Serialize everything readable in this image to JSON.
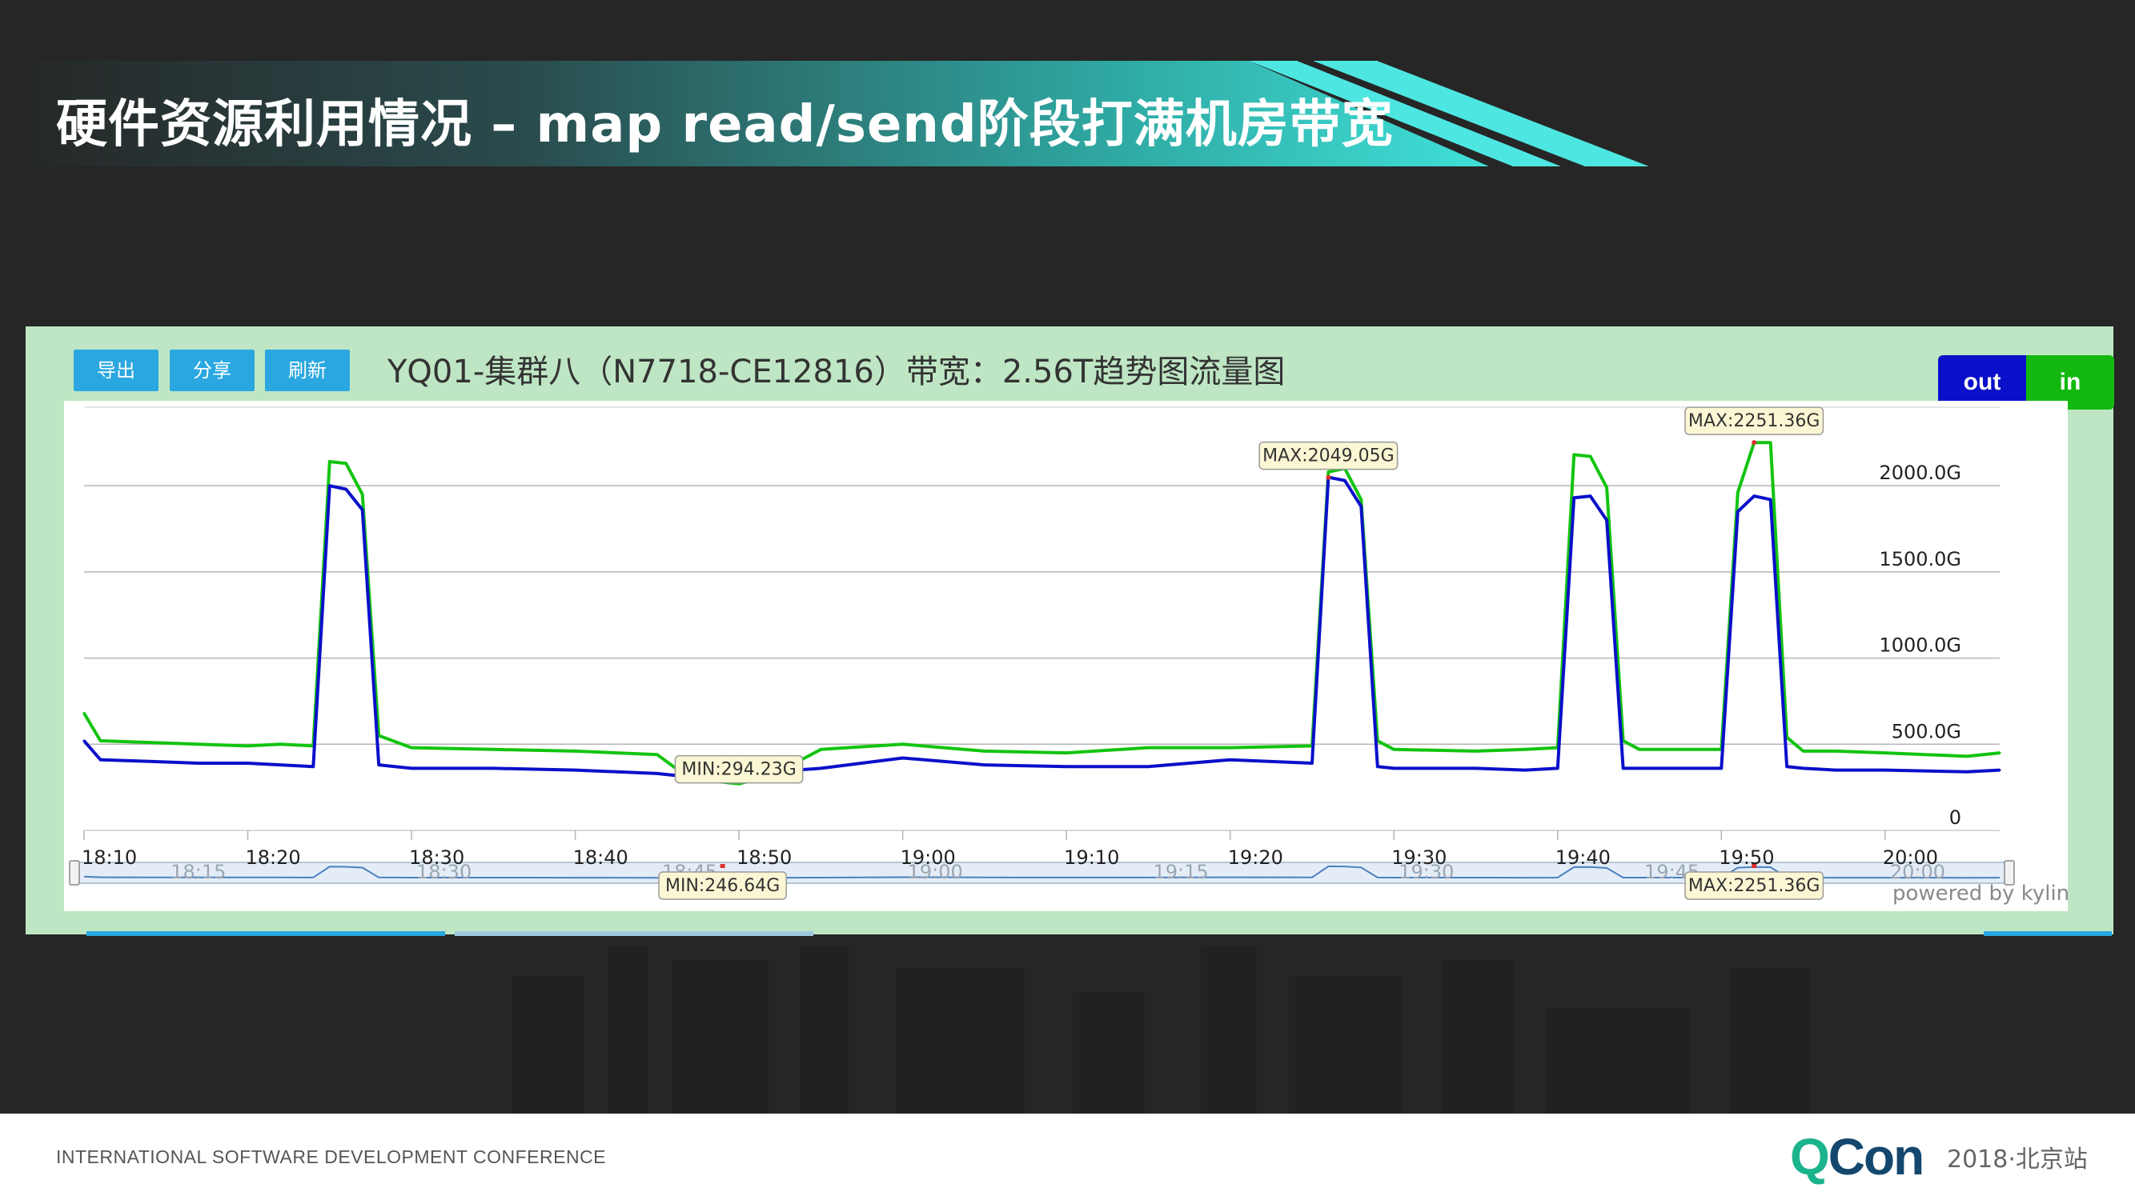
{
  "slide": {
    "title": "硬件资源利用情况 – map read/send阶段打满机房带宽",
    "conference": "INTERNATIONAL SOFTWARE DEVELOPMENT CONFERENCE",
    "logo_q": "Q",
    "logo_con": "Con",
    "edition": "2018·北京站"
  },
  "toolbar": {
    "export_label": "导出",
    "share_label": "分享",
    "refresh_label": "刷新"
  },
  "toggles": {
    "out_label": "out",
    "in_label": "in"
  },
  "powered_by": "powered by kylin",
  "colors": {
    "in": "#12c40f",
    "out": "#0a10c9",
    "accent": "#2aa7e0",
    "panel": "#bfe6c4"
  },
  "chart_data": {
    "type": "line",
    "title": "YQ01-集群八（N7718-CE12816）带宽：2.56T趋势图流量图",
    "xlabel": "",
    "ylabel": "",
    "x_range": [
      "18:10",
      "20:07"
    ],
    "ylim": [
      0,
      2400
    ],
    "y_ticks": [
      0,
      500,
      1000,
      1500,
      2000
    ],
    "y_tick_labels": [
      "0",
      "500.0G",
      "1000.0G",
      "1500.0G",
      "2000.0G"
    ],
    "x_tick_labels": [
      "18:10",
      "18:20",
      "18:30",
      "18:40",
      "18:50",
      "19:00",
      "19:10",
      "19:20",
      "19:30",
      "19:40",
      "19:50",
      "20:00"
    ],
    "navigator_tick_labels": [
      "18:15",
      "18:30",
      "18:45",
      "19:00",
      "19:15",
      "19:30",
      "19:45",
      "20:00"
    ],
    "grid": "horizontal",
    "legend": "top-right toggles",
    "series": [
      {
        "name": "in",
        "color": "#12c40f",
        "x": [
          "18:10",
          "18:11",
          "18:14",
          "18:17",
          "18:20",
          "18:22",
          "18:24",
          "18:25",
          "18:26",
          "18:27",
          "18:28",
          "18:30",
          "18:35",
          "18:40",
          "18:45",
          "18:47",
          "18:50",
          "18:52",
          "18:55",
          "19:00",
          "19:05",
          "19:10",
          "19:15",
          "19:20",
          "19:25",
          "19:26",
          "19:27",
          "19:28",
          "19:29",
          "19:30",
          "19:35",
          "19:38",
          "19:40",
          "19:41",
          "19:42",
          "19:43",
          "19:44",
          "19:45",
          "19:50",
          "19:51",
          "19:52",
          "19:53",
          "19:54",
          "19:55",
          "19:57",
          "20:00",
          "20:05",
          "20:07"
        ],
        "values": [
          680,
          520,
          510,
          500,
          490,
          500,
          490,
          2140,
          2130,
          1950,
          550,
          480,
          470,
          460,
          440,
          300,
          270,
          320,
          470,
          500,
          460,
          450,
          480,
          480,
          490,
          2080,
          2100,
          1920,
          520,
          470,
          460,
          470,
          480,
          2180,
          2170,
          1990,
          520,
          470,
          470,
          1960,
          2250,
          2250,
          540,
          460,
          460,
          450,
          430,
          450
        ]
      },
      {
        "name": "out",
        "color": "#0a10c9",
        "x": [
          "18:10",
          "18:11",
          "18:14",
          "18:17",
          "18:20",
          "18:22",
          "18:24",
          "18:25",
          "18:26",
          "18:27",
          "18:28",
          "18:30",
          "18:35",
          "18:40",
          "18:45",
          "18:47",
          "18:50",
          "18:52",
          "18:55",
          "19:00",
          "19:05",
          "19:10",
          "19:15",
          "19:20",
          "19:25",
          "19:26",
          "19:27",
          "19:28",
          "19:29",
          "19:30",
          "19:35",
          "19:38",
          "19:40",
          "19:41",
          "19:42",
          "19:43",
          "19:44",
          "19:45",
          "19:50",
          "19:51",
          "19:52",
          "19:53",
          "19:54",
          "19:55",
          "19:57",
          "20:00",
          "20:05",
          "20:07"
        ],
        "values": [
          520,
          410,
          400,
          390,
          390,
          380,
          370,
          2000,
          1980,
          1860,
          380,
          360,
          360,
          350,
          330,
          310,
          294,
          340,
          360,
          420,
          380,
          370,
          370,
          410,
          390,
          2049,
          2030,
          1880,
          370,
          360,
          360,
          350,
          360,
          1930,
          1940,
          1800,
          360,
          360,
          360,
          1850,
          1940,
          1920,
          370,
          360,
          350,
          350,
          340,
          350
        ]
      }
    ],
    "annotations": [
      {
        "label": "MAX:2049.05G",
        "x": "19:26",
        "y": 2049,
        "series": "out"
      },
      {
        "label": "MAX:2251.36G",
        "x": "19:52",
        "y": 2251,
        "series": "in"
      },
      {
        "label": "MIN:294.23G",
        "x": "18:50",
        "y": 294,
        "series": "out"
      }
    ],
    "navigator_annotations": [
      {
        "label": "MIN:246.64G",
        "x": "18:49"
      },
      {
        "label": "MAX:2251.36G",
        "x": "19:52"
      }
    ]
  }
}
